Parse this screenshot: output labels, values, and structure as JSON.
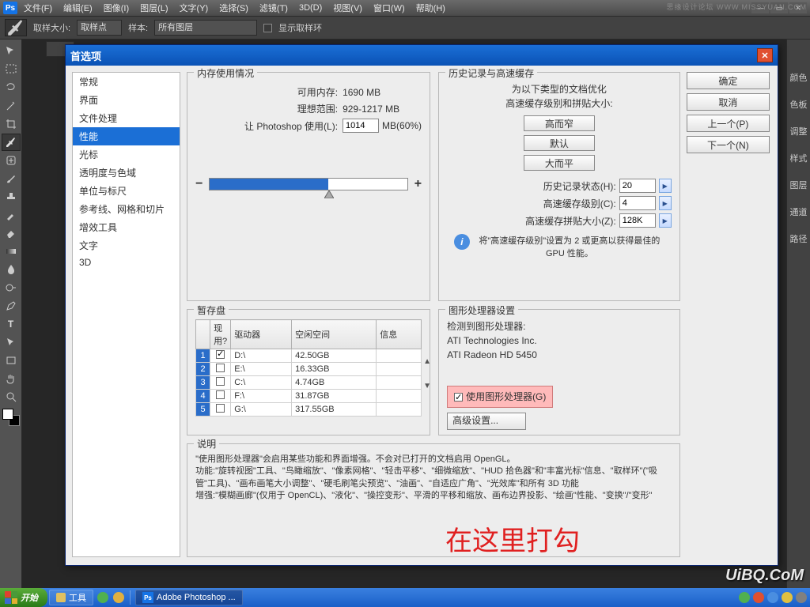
{
  "menubar": {
    "logo": "Ps",
    "items": [
      "文件(F)",
      "编辑(E)",
      "图像(I)",
      "图层(L)",
      "文字(Y)",
      "选择(S)",
      "滤镜(T)",
      "3D(D)",
      "视图(V)",
      "窗口(W)",
      "帮助(H)"
    ]
  },
  "optbar": {
    "label1": "取样大小:",
    "sel1": "取样点",
    "label2": "样本:",
    "sel2": "所有图层",
    "chk_label": "显示取样环"
  },
  "panels": [
    "颜色",
    "色板",
    "调整",
    "样式",
    "图层",
    "通道",
    "路径"
  ],
  "dialog": {
    "title": "首选项",
    "categories": [
      "常规",
      "界面",
      "文件处理",
      "性能",
      "光标",
      "透明度与色域",
      "单位与标尺",
      "参考线、网格和切片",
      "增效工具",
      "文字",
      "3D"
    ],
    "selected_index": 3,
    "buttons": {
      "ok": "确定",
      "cancel": "取消",
      "prev": "上一个(P)",
      "next": "下一个(N)"
    },
    "memory": {
      "legend": "内存使用情况",
      "avail_l": "可用内存:",
      "avail_v": "1690 MB",
      "ideal_l": "理想范围:",
      "ideal_v": "929-1217 MB",
      "use_l": "让 Photoshop 使用(L):",
      "use_v": "1014",
      "use_suffix": "MB(60%)"
    },
    "history": {
      "legend": "历史记录与高速缓存",
      "line1": "为以下类型的文档优化",
      "line2": "高速缓存级别和拼贴大小:",
      "b1": "高而窄",
      "b2": "默认",
      "b3": "大而平",
      "f1_l": "历史记录状态(H):",
      "f1_v": "20",
      "f2_l": "高速缓存级别(C):",
      "f2_v": "4",
      "f3_l": "高速缓存拼贴大小(Z):",
      "f3_v": "128K",
      "info": "将\"高速缓存级别\"设置为 2 或更高以获得最佳的 GPU 性能。"
    },
    "scratch": {
      "legend": "暂存盘",
      "headers": [
        "",
        "现用?",
        "驱动器",
        "空闲空间",
        "信息"
      ],
      "rows": [
        {
          "n": "1",
          "on": true,
          "drive": "D:\\",
          "free": "42.50GB",
          "info": ""
        },
        {
          "n": "2",
          "on": false,
          "drive": "E:\\",
          "free": "16.33GB",
          "info": ""
        },
        {
          "n": "3",
          "on": false,
          "drive": "C:\\",
          "free": "4.74GB",
          "info": ""
        },
        {
          "n": "4",
          "on": false,
          "drive": "F:\\",
          "free": "31.87GB",
          "info": ""
        },
        {
          "n": "5",
          "on": false,
          "drive": "G:\\",
          "free": "317.55GB",
          "info": ""
        }
      ]
    },
    "gpu": {
      "legend": "图形处理器设置",
      "detected": "检测到图形处理器:",
      "vendor": "ATI Technologies Inc.",
      "model": "ATI Radeon HD 5450",
      "use_label": "使用图形处理器(G)",
      "adv": "高级设置..."
    },
    "desc": {
      "legend": "说明",
      "text": "\"使用图形处理器\"会启用某些功能和界面增强。不会对已打开的文档启用 OpenGL。\n功能:\"旋转视图\"工具、\"鸟瞰缩放\"、\"像素网格\"、\"轻击平移\"、\"细微缩放\"、\"HUD 拾色器\"和\"丰富光标\"信息、\"取样环\"(\"吸管\"工具)、\"画布画笔大小调整\"、\"硬毛刷笔尖预览\"、\"油画\"、\"自适应广角\"、\"光效库\"和所有 3D 功能\n增强:\"模糊画廊\"(仅用于 OpenCL)、\"液化\"、\"操控变形\"、平滑的平移和缩放、画布边界投影、\"绘画\"性能、\"变换\"/\"变形\""
    }
  },
  "annotation": "在这里打勾",
  "taskbar": {
    "start": "开始",
    "tools": "工具",
    "app": "Adobe Photoshop ..."
  },
  "watermark_top": "思缘设计论坛 WWW.MISSYUAN.COM",
  "watermark_bottom": "UiBQ.CoM"
}
